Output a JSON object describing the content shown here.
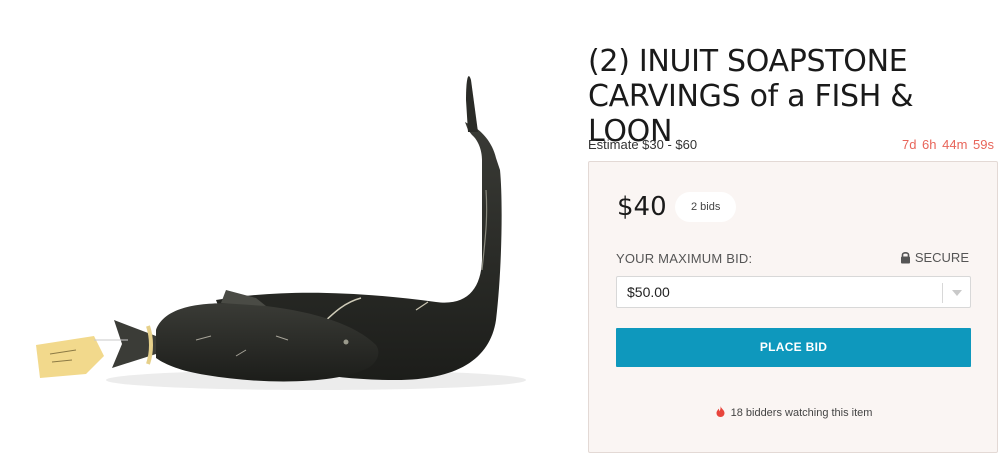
{
  "lot": {
    "title_line1": "(2) INUIT SOAPSTONE",
    "title_line2": "CARVINGS of a FISH & LOON",
    "estimate": "Estimate $30 - $60",
    "countdown": "7d 6h 44m 59s",
    "image_icon": "soapstone-carvings-photo"
  },
  "bid": {
    "current_price": "$40",
    "bids_count": "2 bids",
    "max_bid_label": "YOUR MAXIMUM BID:",
    "secure_label": "SECURE",
    "selected_bid": "$50.00",
    "place_bid_label": "PLACE BID",
    "watchers_text": "18 bidders watching this item"
  },
  "colors": {
    "accent_button": "#0e98bd",
    "countdown": "#e8655a",
    "panel_bg": "#faf5f3",
    "flame": "#e8453c"
  },
  "icons": [
    "lock-icon",
    "chevron-down-icon",
    "flame-icon"
  ]
}
